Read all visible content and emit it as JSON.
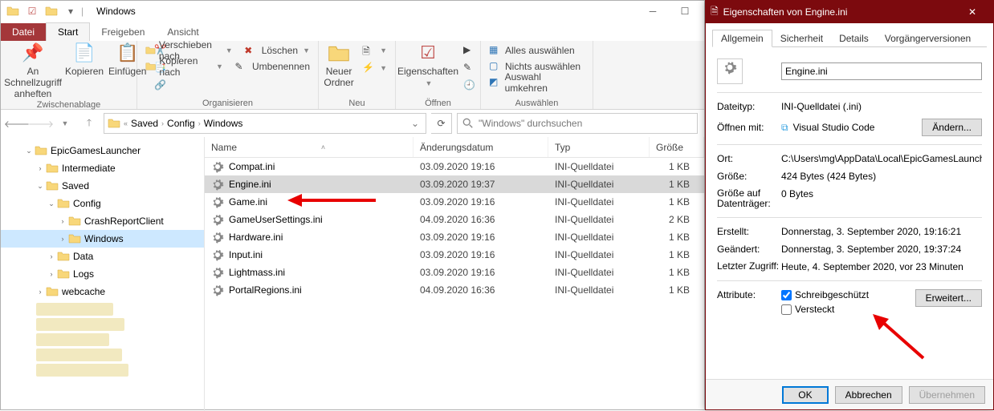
{
  "explorer": {
    "title": "Windows",
    "menu_file": "Datei",
    "tabs": {
      "start": "Start",
      "share": "Freigeben",
      "view": "Ansicht"
    },
    "ribbon": {
      "clipboard": {
        "label": "Zwischenablage",
        "pin": "An Schnellzugriff anheften",
        "copy": "Kopieren",
        "paste": "Einfügen"
      },
      "organize": {
        "label": "Organisieren",
        "move_to": "Verschieben nach",
        "copy_to": "Kopieren nach",
        "delete": "Löschen",
        "rename": "Umbenennen"
      },
      "new": {
        "label": "Neu",
        "new_folder": "Neuer Ordner"
      },
      "open": {
        "label": "Öffnen",
        "properties": "Eigenschaften"
      },
      "select": {
        "label": "Auswählen",
        "select_all": "Alles auswählen",
        "select_none": "Nichts auswählen",
        "invert": "Auswahl umkehren"
      }
    },
    "breadcrumbs": [
      "Saved",
      "Config",
      "Windows"
    ],
    "search_placeholder": "\"Windows\" durchsuchen",
    "tree": [
      {
        "indent": 28,
        "label": "EpicGamesLauncher",
        "expanded": true
      },
      {
        "indent": 42,
        "label": "Intermediate",
        "expanded": false
      },
      {
        "indent": 42,
        "label": "Saved",
        "expanded": true
      },
      {
        "indent": 56,
        "label": "Config",
        "expanded": true
      },
      {
        "indent": 70,
        "label": "CrashReportClient",
        "expanded": false
      },
      {
        "indent": 70,
        "label": "Windows",
        "expanded": false,
        "selected": true
      },
      {
        "indent": 56,
        "label": "Data",
        "expanded": false
      },
      {
        "indent": 56,
        "label": "Logs",
        "expanded": false
      },
      {
        "indent": 42,
        "label": "webcache",
        "expanded": false
      }
    ],
    "columns": {
      "name": "Name",
      "date": "Änderungsdatum",
      "type": "Typ",
      "size": "Größe"
    },
    "files": [
      {
        "name": "Compat.ini",
        "date": "03.09.2020 19:16",
        "type": "INI-Quelldatei",
        "size": "1 KB"
      },
      {
        "name": "Engine.ini",
        "date": "03.09.2020 19:37",
        "type": "INI-Quelldatei",
        "size": "1 KB",
        "selected": true
      },
      {
        "name": "Game.ini",
        "date": "03.09.2020 19:16",
        "type": "INI-Quelldatei",
        "size": "1 KB"
      },
      {
        "name": "GameUserSettings.ini",
        "date": "04.09.2020 16:36",
        "type": "INI-Quelldatei",
        "size": "2 KB"
      },
      {
        "name": "Hardware.ini",
        "date": "03.09.2020 19:16",
        "type": "INI-Quelldatei",
        "size": "1 KB"
      },
      {
        "name": "Input.ini",
        "date": "03.09.2020 19:16",
        "type": "INI-Quelldatei",
        "size": "1 KB"
      },
      {
        "name": "Lightmass.ini",
        "date": "03.09.2020 19:16",
        "type": "INI-Quelldatei",
        "size": "1 KB"
      },
      {
        "name": "PortalRegions.ini",
        "date": "04.09.2020 16:36",
        "type": "INI-Quelldatei",
        "size": "1 KB"
      }
    ]
  },
  "props": {
    "title": "Eigenschaften von Engine.ini",
    "tabs": {
      "general": "Allgemein",
      "security": "Sicherheit",
      "details": "Details",
      "prev": "Vorgängerversionen"
    },
    "filename": "Engine.ini",
    "labels": {
      "filetype": "Dateityp:",
      "opens_with": "Öffnen mit:",
      "location": "Ort:",
      "size": "Größe:",
      "size_on_disk": "Größe auf Datenträger:",
      "created": "Erstellt:",
      "modified": "Geändert:",
      "accessed": "Letzter Zugriff:",
      "attributes": "Attribute:"
    },
    "values": {
      "filetype": "INI-Quelldatei (.ini)",
      "opens_with": "Visual Studio Code",
      "location": "C:\\Users\\mg\\AppData\\Local\\EpicGamesLauncher\\",
      "size": "424 Bytes (424 Bytes)",
      "size_on_disk": "0 Bytes",
      "created": "Donnerstag, 3. September 2020, 19:16:21",
      "modified": "Donnerstag, 3. September 2020, 19:37:24",
      "accessed": "Heute, 4. September 2020, vor 23 Minuten"
    },
    "attr_readonly": "Schreibgeschützt",
    "attr_hidden": "Versteckt",
    "btn_change": "Ändern...",
    "btn_advanced": "Erweitert...",
    "btn_ok": "OK",
    "btn_cancel": "Abbrechen",
    "btn_apply": "Übernehmen"
  }
}
